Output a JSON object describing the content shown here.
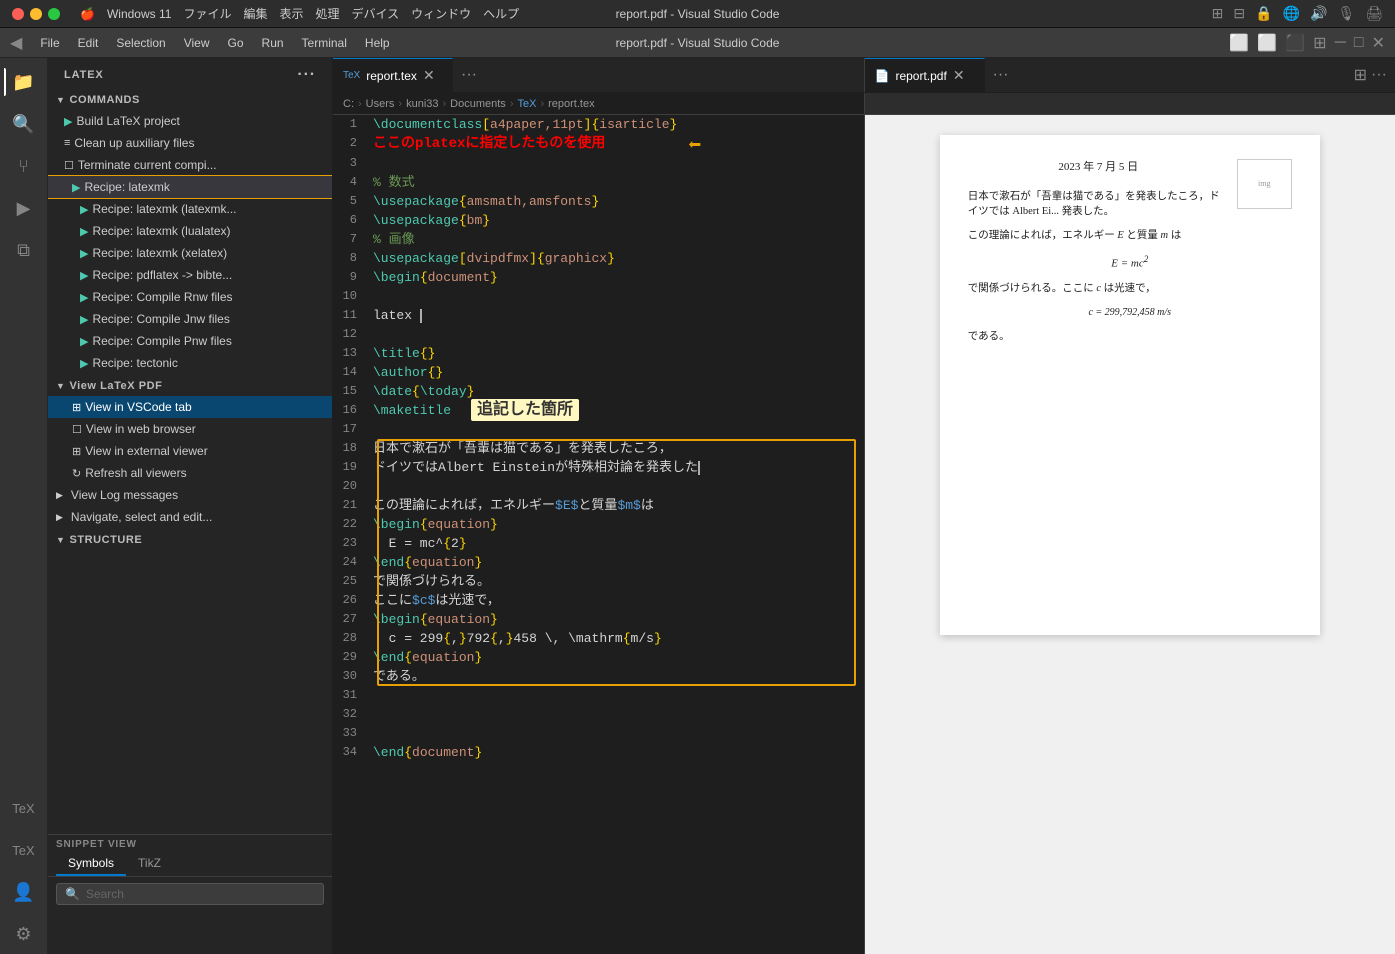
{
  "window": {
    "os_title": "Windows 11",
    "app_title": "report.pdf - Visual Studio Code"
  },
  "mac_menu": {
    "items": [
      "ファイル",
      "編集",
      "表示",
      "処理",
      "デバイス",
      "ウィンドウ",
      "ヘルプ"
    ]
  },
  "vscode_menu": {
    "items": [
      "File",
      "Edit",
      "Selection",
      "View",
      "Go",
      "Run",
      "Terminal",
      "Help"
    ]
  },
  "tabs": {
    "left": {
      "label": "report.tex",
      "more": "···"
    },
    "right": {
      "label": "report.pdf",
      "more": "···"
    }
  },
  "breadcrumb": {
    "parts": [
      "C:",
      "Users",
      "kuni33",
      "Documents",
      "TeX",
      "report.tex"
    ]
  },
  "sidebar": {
    "header": "LATEX",
    "sections": {
      "commands": {
        "label": "COMMANDS",
        "items": [
          {
            "id": "build",
            "label": "Build LaTeX project",
            "icon": "triangle-right",
            "indent": 16
          },
          {
            "id": "cleanup",
            "label": "Clean up auxiliary files",
            "icon": "dash",
            "indent": 16
          },
          {
            "id": "terminate",
            "label": "Terminate current compi...",
            "icon": "square",
            "indent": 16
          },
          {
            "id": "recipe-latexmk",
            "label": "Recipe: latexmk",
            "icon": "triangle-right",
            "indent": 24,
            "highlighted": true
          },
          {
            "id": "recipe-latexmk-latexmk",
            "label": "Recipe: latexmk (latexmk...",
            "icon": "triangle-right",
            "indent": 32
          },
          {
            "id": "recipe-latexmk-lualatex",
            "label": "Recipe: latexmk (lualatex)",
            "icon": "triangle-right",
            "indent": 32
          },
          {
            "id": "recipe-latexmk-xelatex",
            "label": "Recipe: latexmk (xelatex)",
            "icon": "triangle-right",
            "indent": 32
          },
          {
            "id": "recipe-pdflatex",
            "label": "Recipe: pdflatex -> bibte...",
            "icon": "triangle-right",
            "indent": 32
          },
          {
            "id": "recipe-compile-rnw",
            "label": "Recipe: Compile Rnw files",
            "icon": "triangle-right",
            "indent": 32
          },
          {
            "id": "recipe-compile-jnw",
            "label": "Recipe: Compile Jnw files",
            "icon": "triangle-right",
            "indent": 32
          },
          {
            "id": "recipe-compile-pnw",
            "label": "Recipe: Compile Pnw files",
            "icon": "triangle-right",
            "indent": 32
          },
          {
            "id": "recipe-tectonic",
            "label": "Recipe: tectonic",
            "icon": "triangle-right",
            "indent": 32
          }
        ]
      },
      "view_latex_pdf": {
        "label": "View LaTeX PDF",
        "items": [
          {
            "id": "view-vscode",
            "label": "View in VSCode tab",
            "icon": "square",
            "indent": 24,
            "selected": true
          },
          {
            "id": "view-browser",
            "label": "View in web browser",
            "icon": "square",
            "indent": 24
          },
          {
            "id": "view-external",
            "label": "View in external viewer",
            "icon": "square",
            "indent": 24
          },
          {
            "id": "refresh",
            "label": "Refresh all viewers",
            "icon": "refresh",
            "indent": 24
          }
        ]
      },
      "view_log": {
        "label": "View Log messages",
        "indent": 8
      },
      "navigate": {
        "label": "Navigate, select and edit...",
        "indent": 8
      },
      "structure": {
        "label": "STRUCTURE"
      }
    }
  },
  "snippet_view": {
    "label": "SNIPPET VIEW",
    "tabs": [
      "Symbols",
      "TikZ"
    ],
    "active_tab": "Symbols",
    "search_placeholder": "Search"
  },
  "code": {
    "lines": [
      {
        "num": 1,
        "text": "\\documentclass[a4paper,11pt]{isarticle}"
      },
      {
        "num": 2,
        "text": "ここのplatexに指定したものを使用",
        "annotation": true
      },
      {
        "num": 3,
        "text": ""
      },
      {
        "num": 4,
        "text": "% 数式"
      },
      {
        "num": 5,
        "text": "\\usepackage{amsmath,amsfonts}"
      },
      {
        "num": 6,
        "text": "\\usepackage{bm}"
      },
      {
        "num": 7,
        "text": "% 画像"
      },
      {
        "num": 8,
        "text": "\\usepackage[dvipdfmx]{graphicx}"
      },
      {
        "num": 9,
        "text": "\\begin{document}"
      },
      {
        "num": 10,
        "text": ""
      },
      {
        "num": 11,
        "text": "latex"
      },
      {
        "num": 12,
        "text": ""
      },
      {
        "num": 13,
        "text": "\\title{}"
      },
      {
        "num": 14,
        "text": "\\author{}"
      },
      {
        "num": 15,
        "text": "\\date{\\today}"
      },
      {
        "num": 16,
        "text": "\\maketitle"
      },
      {
        "num": 17,
        "text": ""
      },
      {
        "num": 18,
        "text": "日本で漱石が「吾輩は猫である」を発表したころ，"
      },
      {
        "num": 19,
        "text": "ドイツではAlbert Einsteinが特殊相対論を発表した"
      },
      {
        "num": 20,
        "text": ""
      },
      {
        "num": 21,
        "text": "この理論によれば，エネルギー$E$と質量$m$は"
      },
      {
        "num": 22,
        "text": "\\begin{equation}"
      },
      {
        "num": 23,
        "text": "  E = mc^{2}"
      },
      {
        "num": 24,
        "text": "\\end{equation}"
      },
      {
        "num": 25,
        "text": "で関係づけられる。"
      },
      {
        "num": 26,
        "text": "ここに$c$は光速で，"
      },
      {
        "num": 27,
        "text": "\\begin{equation}"
      },
      {
        "num": 28,
        "text": "  c = 299{,}792{,}458 \\, \\mathrm{m/s}"
      },
      {
        "num": 29,
        "text": "\\end{equation}"
      },
      {
        "num": 30,
        "text": "である。"
      },
      {
        "num": 31,
        "text": ""
      },
      {
        "num": 32,
        "text": ""
      },
      {
        "num": 33,
        "text": ""
      },
      {
        "num": 34,
        "text": "\\end{document}"
      }
    ]
  },
  "annotation": {
    "line2_text": "ここのplatexに指定したものを使用",
    "box_label": "追記した箇所"
  },
  "pdf": {
    "date": "2023 年 7 月 5 日",
    "para1": "日本で漱石が「吾輩は猫である」を発表したころ，ドイツでは Albert Ei... 発表した。",
    "para2": "この理論によれば，エネルギー E と質量 m は",
    "eq1": "E = mc²",
    "para3": "で関係づけられる。ここに c は光速で，",
    "eq2": "c = 299,792,458 m/s",
    "para4": "である。"
  }
}
